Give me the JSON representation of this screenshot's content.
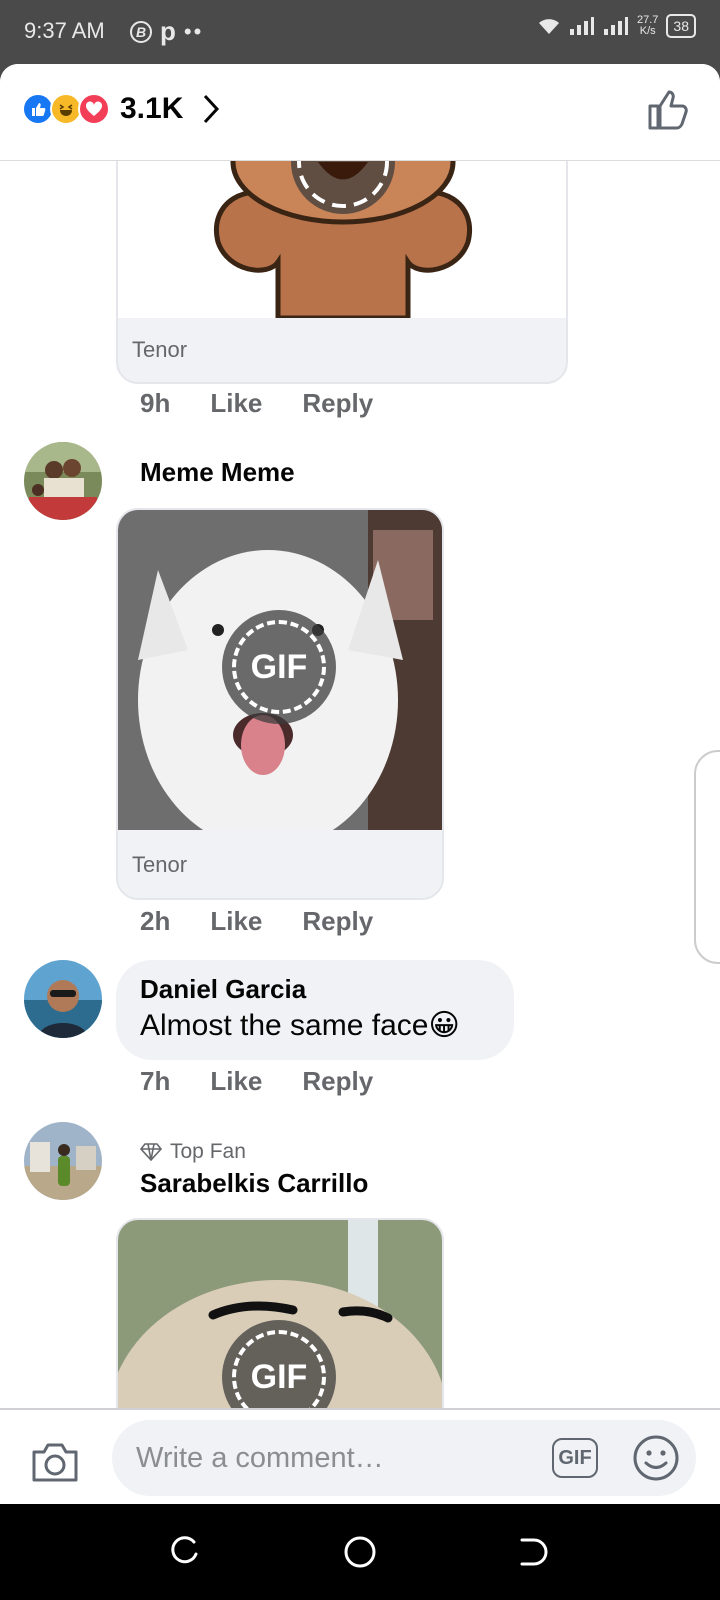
{
  "status_bar": {
    "time": "9:37 AM",
    "badge_letter": "B",
    "app_letter": "p",
    "dots": "••",
    "speed_value": "27.7",
    "speed_unit": "K/s",
    "battery": "38"
  },
  "header": {
    "reaction_icons": [
      "like-icon",
      "haha-icon",
      "love-icon"
    ],
    "reaction_count": "3.1K"
  },
  "comments": [
    {
      "gif_source": "Tenor",
      "time": "9h",
      "like_label": "Like",
      "reply_label": "Reply"
    },
    {
      "author": "Meme Meme",
      "gif_label": "GIF",
      "gif_source": "Tenor",
      "time": "2h",
      "like_label": "Like",
      "reply_label": "Reply"
    },
    {
      "author": "Daniel Garcia",
      "text": "Almost the same face",
      "emoji": "😀",
      "time": "7h",
      "like_label": "Like",
      "reply_label": "Reply"
    },
    {
      "badge": "Top Fan",
      "author": "Sarabelkis Carrillo",
      "gif_label": "GIF"
    }
  ],
  "composer": {
    "placeholder": "Write a comment…",
    "gif_label": "GIF"
  },
  "colors": {
    "accent": "#1877f2",
    "bubble": "#f0f2f5",
    "meta_text": "#65676b"
  }
}
